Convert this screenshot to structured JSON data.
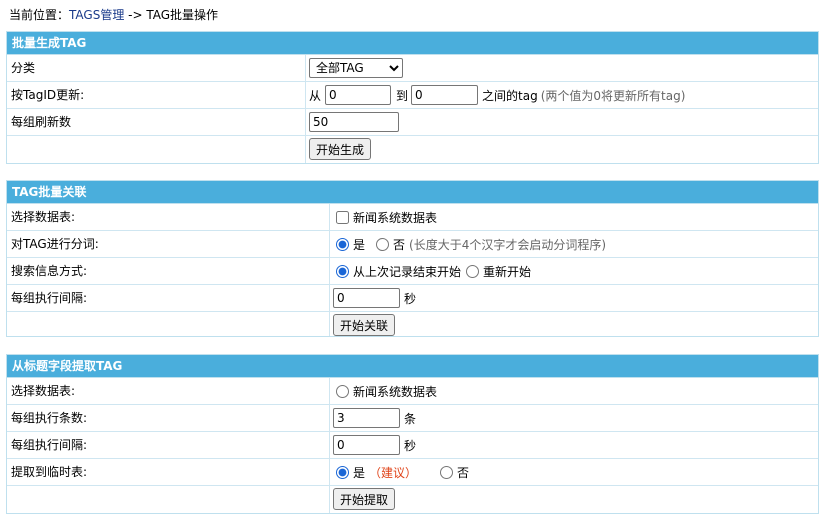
{
  "breadcrumb": {
    "prefix": "当前位置：",
    "link": "TAGS管理",
    "suffix": " -> TAG批量操作"
  },
  "panel1": {
    "title": "批量生成TAG",
    "category_label": "分类",
    "category_selected": "全部TAG",
    "range_label": "按TagID更新:",
    "from_text": "从",
    "from_value": "0",
    "to_text": "到",
    "to_value": "0",
    "between_text": "之间的tag",
    "between_hint": "(两个值为0将更新所有tag)",
    "per_group_label": "每组刷新数",
    "per_group_value": "50",
    "start_button": "开始生成"
  },
  "panel2": {
    "title": "TAG批量关联",
    "table_label": "选择数据表:",
    "table_option": "新闻系统数据表",
    "segment_label": "对TAG进行分词:",
    "segment_yes": "是",
    "segment_no": "否",
    "segment_hint": "(长度大于4个汉字才会启动分词程序)",
    "search_label": "搜索信息方式:",
    "search_continue": "从上次记录结束开始",
    "search_restart": "重新开始",
    "interval_label": "每组执行间隔:",
    "interval_value": "0",
    "interval_unit": "秒",
    "start_button": "开始关联"
  },
  "panel3": {
    "title": "从标题字段提取TAG",
    "table_label": "选择数据表:",
    "table_option": "新闻系统数据表",
    "count_label": "每组执行条数:",
    "count_value": "3",
    "count_unit": "条",
    "interval_label": "每组执行间隔:",
    "interval_value": "0",
    "interval_unit": "秒",
    "temp_label": "提取到临时表:",
    "temp_yes": "是",
    "temp_recommend": "（建议）",
    "temp_no": "否",
    "start_button": "开始提取"
  },
  "colors": {
    "header_bg": "#4aaedc",
    "border": "#cfe6f1",
    "link": "#1a3a8a",
    "recommend": "#e0441a"
  }
}
